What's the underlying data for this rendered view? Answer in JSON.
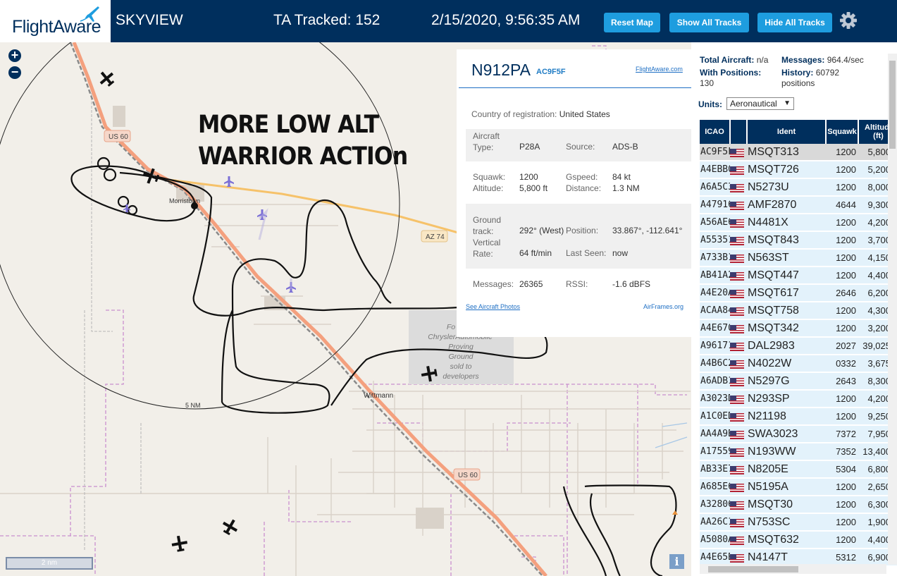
{
  "header": {
    "logo_text": "FlightAware",
    "title": "SKYVIEW",
    "tracked": "TA Tracked: 152",
    "datetime": "2/15/2020, 9:56:35 AM",
    "buttons": {
      "reset_map": "Reset Map",
      "show_all": "Show All Tracks",
      "hide_all": "Hide All Tracks"
    }
  },
  "map": {
    "zoom_in": "+",
    "zoom_out": "−",
    "annotation_line1": "MORE LOW ALT",
    "annotation_line2": "WARRIOR ACTIOn",
    "labels": {
      "us60_north": "US 60",
      "us60_south": "US 60",
      "az74": "AZ 74",
      "morristown": "Morristown",
      "wittmann": "Wittmann",
      "range_ring": "5 NM",
      "proving_ground": [
        "Fo",
        "ChryslerAutomobile",
        "Proving",
        "Ground",
        "sold to",
        "developers"
      ]
    },
    "scale": "2 nm",
    "info": "i"
  },
  "selected": {
    "registration": "N912PA",
    "hex": "AC9F5F",
    "site_link": "FlightAware.com",
    "country_label": "Country of registration:",
    "country": "United States",
    "aircraft_type_label": "Aircraft Type:",
    "aircraft_type": "P28A",
    "source_label": "Source:",
    "source": "ADS-B",
    "squawk_label": "Squawk:",
    "squawk": "1200",
    "altitude_label": "Altitude:",
    "altitude": "5,800 ft",
    "gspeed_label": "Gspeed:",
    "gspeed": "84 kt",
    "distance_label": "Distance:",
    "distance": "1.3 NM",
    "track_label": "Ground track:",
    "track": "292° (West)",
    "position_label": "Position:",
    "position": "33.867°, -112.641°",
    "vrate_label": "Vertical Rate:",
    "vrate": "64 ft/min",
    "last_seen_label": "Last Seen:",
    "last_seen": "now",
    "messages_label": "Messages:",
    "messages": "26365",
    "rssi_label": "RSSI:",
    "rssi": "-1.6 dBFS",
    "photos_link": "See Aircraft Photos",
    "airframes_link": "AirFrames.org"
  },
  "stats": {
    "total_label": "Total Aircraft:",
    "total": "n/a",
    "messages_label": "Messages:",
    "messages": "964.4/sec",
    "positions_label": "With Positions:",
    "positions": "130",
    "history_label": "History:",
    "history": "60792 positions",
    "units_label": "Units:",
    "units": "Aeronautical"
  },
  "table": {
    "headers": {
      "icao": "ICAO",
      "ident": "Ident",
      "squawk": "Squawk",
      "altitude": "Altitude (ft)"
    },
    "rows": [
      {
        "icao": "AC9F5F",
        "ident": "MSQT313",
        "squawk": "1200",
        "alt": "5,800",
        "trend": ""
      },
      {
        "icao": "A4EBB0",
        "ident": "MSQT726",
        "squawk": "1200",
        "alt": "5,200",
        "trend": ""
      },
      {
        "icao": "A6A5C3",
        "ident": "N5273U",
        "squawk": "1200",
        "alt": "8,000",
        "trend": "▲"
      },
      {
        "icao": "A47916",
        "ident": "AMF2870",
        "squawk": "4644",
        "alt": "9,300",
        "trend": ""
      },
      {
        "icao": "A56AE6",
        "ident": "N4481X",
        "squawk": "1200",
        "alt": "4,200",
        "trend": ""
      },
      {
        "icao": "A55351",
        "ident": "MSQT843",
        "squawk": "1200",
        "alt": "3,700",
        "trend": "▲"
      },
      {
        "icao": "A733B1",
        "ident": "N563ST",
        "squawk": "1200",
        "alt": "4,150",
        "trend": ""
      },
      {
        "icao": "AB41A2",
        "ident": "MSQT447",
        "squawk": "1200",
        "alt": "4,400",
        "trend": ""
      },
      {
        "icao": "A4E20A",
        "ident": "MSQT617",
        "squawk": "2646",
        "alt": "6,200",
        "trend": ""
      },
      {
        "icao": "ACAA84",
        "ident": "MSQT758",
        "squawk": "1200",
        "alt": "4,300",
        "trend": ""
      },
      {
        "icao": "A4E670",
        "ident": "MSQT342",
        "squawk": "1200",
        "alt": "3,200",
        "trend": ""
      },
      {
        "icao": "A96171",
        "ident": "DAL2983",
        "squawk": "2027",
        "alt": "39,025",
        "trend": ""
      },
      {
        "icao": "A4B6C2",
        "ident": "N4022W",
        "squawk": "0332",
        "alt": "3,675",
        "trend": ""
      },
      {
        "icao": "A6ADB1",
        "ident": "N5297G",
        "squawk": "2643",
        "alt": "8,300",
        "trend": ""
      },
      {
        "icao": "A3023D",
        "ident": "N293SP",
        "squawk": "1200",
        "alt": "4,200",
        "trend": ""
      },
      {
        "icao": "A1C0ED",
        "ident": "N21198",
        "squawk": "1200",
        "alt": "9,250",
        "trend": ""
      },
      {
        "icao": "AA4A9B",
        "ident": "SWA3023",
        "squawk": "7372",
        "alt": "7,950",
        "trend": "▼"
      },
      {
        "icao": "A17559",
        "ident": "N193WW",
        "squawk": "7352",
        "alt": "13,400",
        "trend": ""
      },
      {
        "icao": "AB33E7",
        "ident": "N8205E",
        "squawk": "5304",
        "alt": "6,800",
        "trend": ""
      },
      {
        "icao": "A685E6",
        "ident": "N5195A",
        "squawk": "1200",
        "alt": "2,650",
        "trend": "▼"
      },
      {
        "icao": "A32806",
        "ident": "MSQT30",
        "squawk": "1200",
        "alt": "6,300",
        "trend": ""
      },
      {
        "icao": "AA26C1",
        "ident": "N753SC",
        "squawk": "1200",
        "alt": "1,900",
        "trend": "▼"
      },
      {
        "icao": "A5080A",
        "ident": "MSQT632",
        "squawk": "1200",
        "alt": "4,400",
        "trend": "▲"
      },
      {
        "icao": "A4E65B",
        "ident": "N4147T",
        "squawk": "5312",
        "alt": "6,900",
        "trend": "▲"
      }
    ]
  },
  "colors": {
    "header_bg": "#002f5d",
    "button_bg": "#1e9ddf",
    "row_bg": "#e3f2fb",
    "track": "#111111",
    "highway": "#f4a07e"
  }
}
